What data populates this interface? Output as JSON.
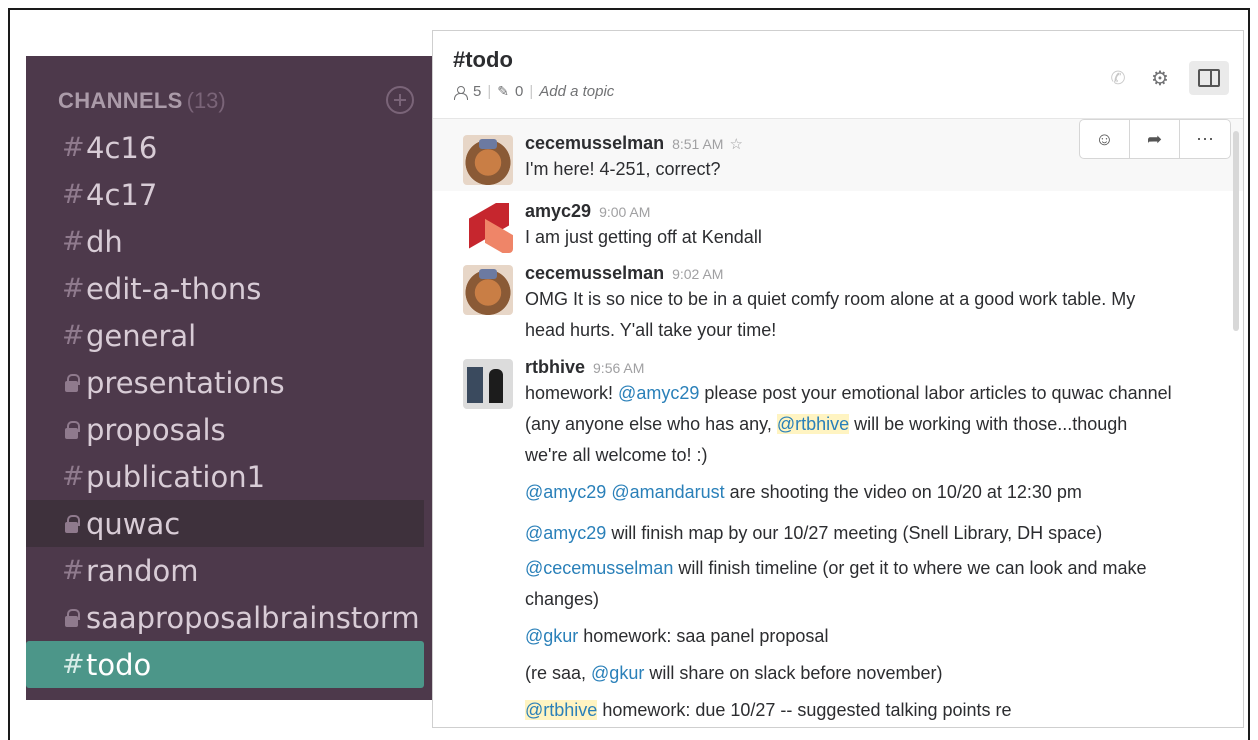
{
  "sidebar": {
    "header_title": "CHANNELS",
    "header_count": "(13)",
    "channels": [
      {
        "prefix": "#",
        "name": "4c16"
      },
      {
        "prefix": "#",
        "name": "4c17"
      },
      {
        "prefix": "#",
        "name": "dh"
      },
      {
        "prefix": "#",
        "name": "edit-a-thons"
      },
      {
        "prefix": "#",
        "name": "general"
      },
      {
        "prefix": "lock",
        "name": "presentations"
      },
      {
        "prefix": "lock",
        "name": "proposals"
      },
      {
        "prefix": "#",
        "name": "publication1"
      },
      {
        "prefix": "lock",
        "name": "quwac"
      },
      {
        "prefix": "#",
        "name": "random"
      },
      {
        "prefix": "lock",
        "name": "saaproposalbrainstorm"
      },
      {
        "prefix": "#",
        "name": "todo"
      }
    ]
  },
  "channel": {
    "title": "#todo",
    "members": "5",
    "pins": "0",
    "topic_placeholder": "Add a topic"
  },
  "messages": [
    {
      "author": "cecemusselman",
      "time": "8:51 AM",
      "text": "I'm here! 4-251, correct?"
    },
    {
      "author": "amyc29",
      "time": "9:00 AM",
      "text": "I am just getting off at Kendall"
    },
    {
      "author": "cecemusselman",
      "time": "9:02 AM",
      "text": "OMG It is so nice to be in a quiet comfy room alone at a good work table. My head hurts. Y'all take your time!"
    },
    {
      "author": "rtbhive",
      "time": "9:56 AM"
    }
  ],
  "rtb": {
    "l1_a": "homework! ",
    "l1_m1": "@amyc29",
    "l1_b": " please post your emotional labor articles to quwac channel (any anyone else who has any, ",
    "l1_m2": "@rtbhive",
    "l1_c": " will be working with those...though we're all welcome to! :)",
    "l2_m1": "@amyc29",
    "l2_m2": "@amandarust",
    "l2_b": " are shooting the video on 10/20 at 12:30 pm",
    "l3_m1": "@amyc29",
    "l3_b": " will finish map by our 10/27 meeting (Snell Library, DH space)",
    "l4_m1": "@cecemusselman",
    "l4_b": " will finish timeline (or get it to where we can look and make changes)",
    "l5_m1": "@gkur",
    "l5_b": " homework: saa panel proposal",
    "l6_a": "(re saa, ",
    "l6_m1": "@gkur",
    "l6_b": " will share on slack before november)",
    "l7_m1": "@rtbhive",
    "l7_b": " homework: due 10/27 -- suggested talking points re"
  }
}
